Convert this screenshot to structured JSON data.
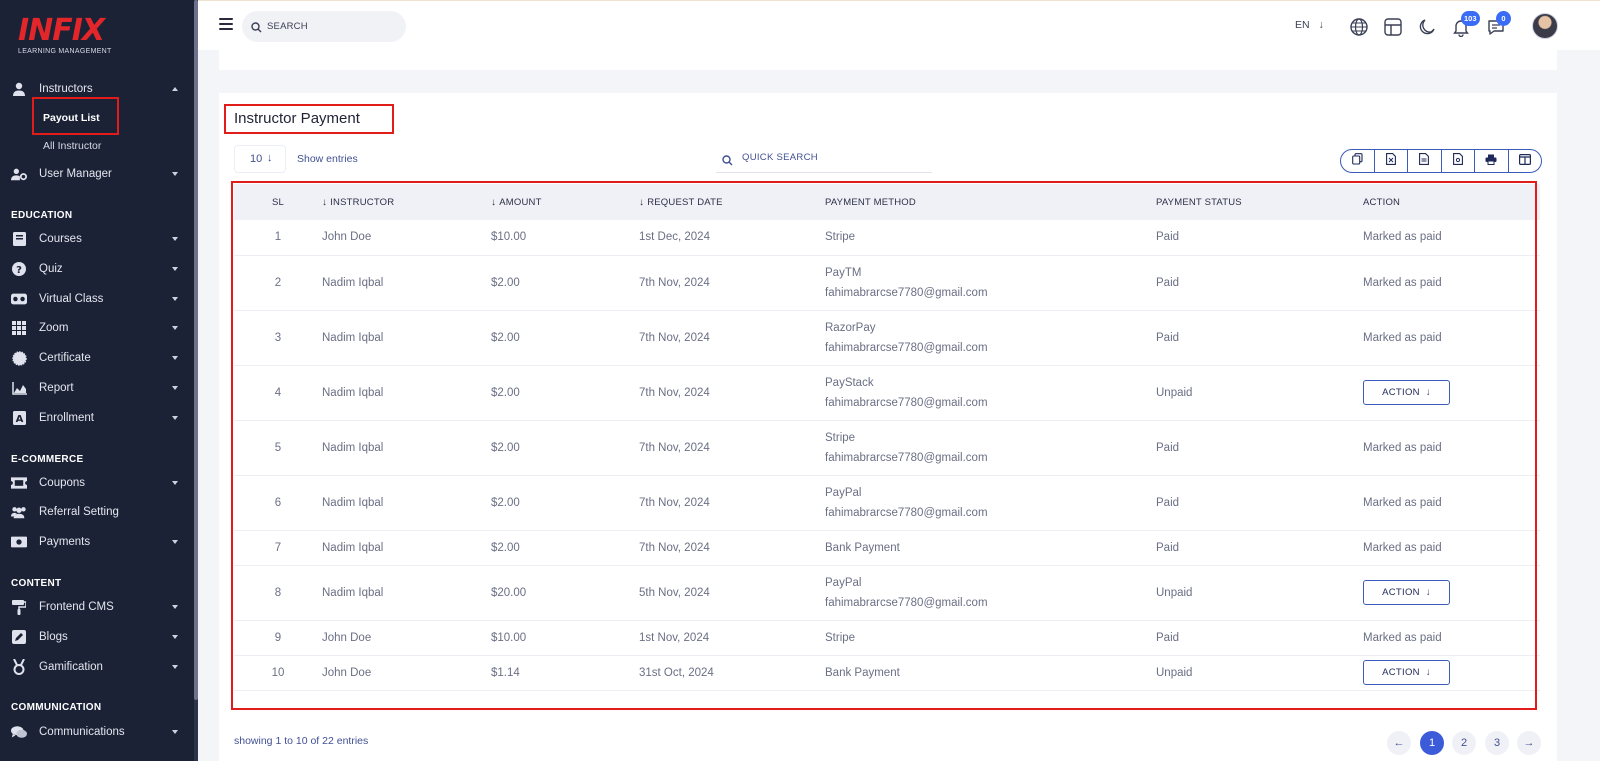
{
  "brand": {
    "logo_text": "INFIX",
    "tagline": "LEARNING MANAGEMENT"
  },
  "sidebar": {
    "instructors": {
      "label": "Instructors",
      "sub": [
        "Payout List",
        "All Instructor"
      ]
    },
    "user_manager": "User Manager",
    "education": {
      "title": "EDUCATION",
      "items": [
        "Courses",
        "Quiz",
        "Virtual Class",
        "Zoom",
        "Certificate",
        "Report",
        "Enrollment"
      ]
    },
    "ecommerce": {
      "title": "E-COMMERCE",
      "items": [
        "Coupons",
        "Referral Setting",
        "Payments"
      ]
    },
    "content": {
      "title": "CONTENT",
      "items": [
        "Frontend CMS",
        "Blogs",
        "Gamification"
      ]
    },
    "communication": {
      "title": "COMMUNICATION",
      "items": [
        "Communications"
      ]
    }
  },
  "topbar": {
    "search_placeholder": "SEARCH",
    "language": "EN",
    "notification_count": "103",
    "message_count": "0"
  },
  "page": {
    "title": "Instructor Payment",
    "entries_value": "10",
    "show_entries": "Show entries",
    "quick_search": "QUICK SEARCH",
    "showing": "showing 1 to 10 of 22 entries",
    "pages": [
      "1",
      "2",
      "3"
    ]
  },
  "table": {
    "headers": [
      "SL",
      "INSTRUCTOR",
      "AMOUNT",
      "REQUEST DATE",
      "PAYMENT METHOD",
      "PAYMENT STATUS",
      "ACTION"
    ],
    "action_button": "ACTION",
    "rows": [
      {
        "sl": "1",
        "instructor": "John Doe",
        "amount": "$10.00",
        "date": "1st Dec, 2024",
        "method": "Stripe",
        "email": "",
        "status": "Paid",
        "action": "Marked as paid"
      },
      {
        "sl": "2",
        "instructor": "Nadim Iqbal",
        "amount": "$2.00",
        "date": "7th Nov, 2024",
        "method": "PayTM",
        "email": "fahimabrarcse7780@gmail.com",
        "status": "Paid",
        "action": "Marked as paid"
      },
      {
        "sl": "3",
        "instructor": "Nadim Iqbal",
        "amount": "$2.00",
        "date": "7th Nov, 2024",
        "method": "RazorPay",
        "email": "fahimabrarcse7780@gmail.com",
        "status": "Paid",
        "action": "Marked as paid"
      },
      {
        "sl": "4",
        "instructor": "Nadim Iqbal",
        "amount": "$2.00",
        "date": "7th Nov, 2024",
        "method": "PayStack",
        "email": "fahimabrarcse7780@gmail.com",
        "status": "Unpaid",
        "action": ""
      },
      {
        "sl": "5",
        "instructor": "Nadim Iqbal",
        "amount": "$2.00",
        "date": "7th Nov, 2024",
        "method": "Stripe",
        "email": "fahimabrarcse7780@gmail.com",
        "status": "Paid",
        "action": "Marked as paid"
      },
      {
        "sl": "6",
        "instructor": "Nadim Iqbal",
        "amount": "$2.00",
        "date": "7th Nov, 2024",
        "method": "PayPal",
        "email": "fahimabrarcse7780@gmail.com",
        "status": "Paid",
        "action": "Marked as paid"
      },
      {
        "sl": "7",
        "instructor": "Nadim Iqbal",
        "amount": "$2.00",
        "date": "7th Nov, 2024",
        "method": "Bank Payment",
        "email": "",
        "status": "Paid",
        "action": "Marked as paid"
      },
      {
        "sl": "8",
        "instructor": "Nadim Iqbal",
        "amount": "$20.00",
        "date": "5th Nov, 2024",
        "method": "PayPal",
        "email": "fahimabrarcse7780@gmail.com",
        "status": "Unpaid",
        "action": ""
      },
      {
        "sl": "9",
        "instructor": "John Doe",
        "amount": "$10.00",
        "date": "1st Nov, 2024",
        "method": "Stripe",
        "email": "",
        "status": "Paid",
        "action": "Marked as paid"
      },
      {
        "sl": "10",
        "instructor": "John Doe",
        "amount": "$1.14",
        "date": "31st Oct, 2024",
        "method": "Bank Payment",
        "email": "",
        "status": "Unpaid",
        "action": ""
      }
    ]
  },
  "colors": {
    "sidebar_bg": "#1b2236",
    "accent": "#3b5bd8",
    "highlight": "#e21b1b",
    "text": "#415094"
  }
}
